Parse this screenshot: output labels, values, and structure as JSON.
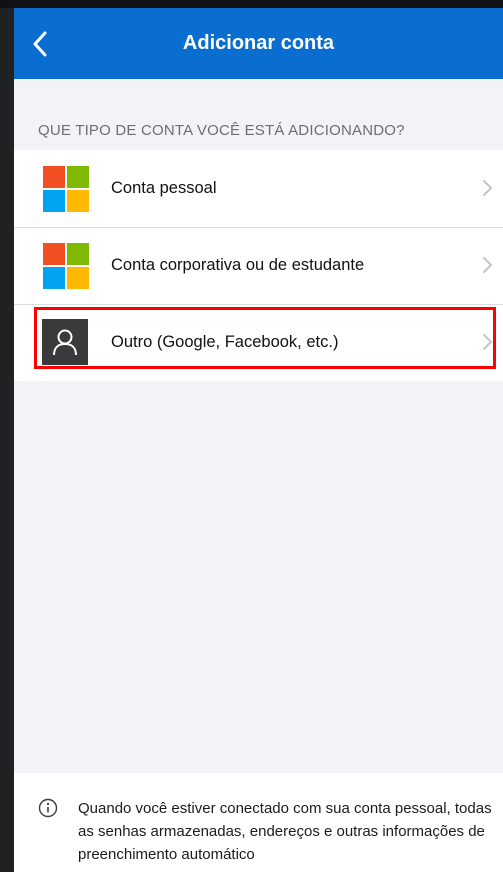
{
  "navbar": {
    "title": "Adicionar conta",
    "back_icon": "chevron-left-icon",
    "color": "#0a6ed1"
  },
  "section_header": "QUE TIPO DE CONTA VOCÊ ESTÁ ADICIONANDO?",
  "accounts": [
    {
      "label": "Conta pessoal",
      "icon": "microsoft-logo-icon"
    },
    {
      "label": "Conta corporativa ou de estudante",
      "icon": "microsoft-logo-icon"
    },
    {
      "label": "Outro (Google, Facebook, etc.)",
      "icon": "person-icon",
      "highlighted": true
    }
  ],
  "highlight_color": "#ff0000",
  "footer": {
    "info_icon": "info-icon",
    "text": "Quando você estiver conectado com sua conta pessoal, todas as senhas armazenadas, endereços e outras informações de preenchimento automático"
  }
}
